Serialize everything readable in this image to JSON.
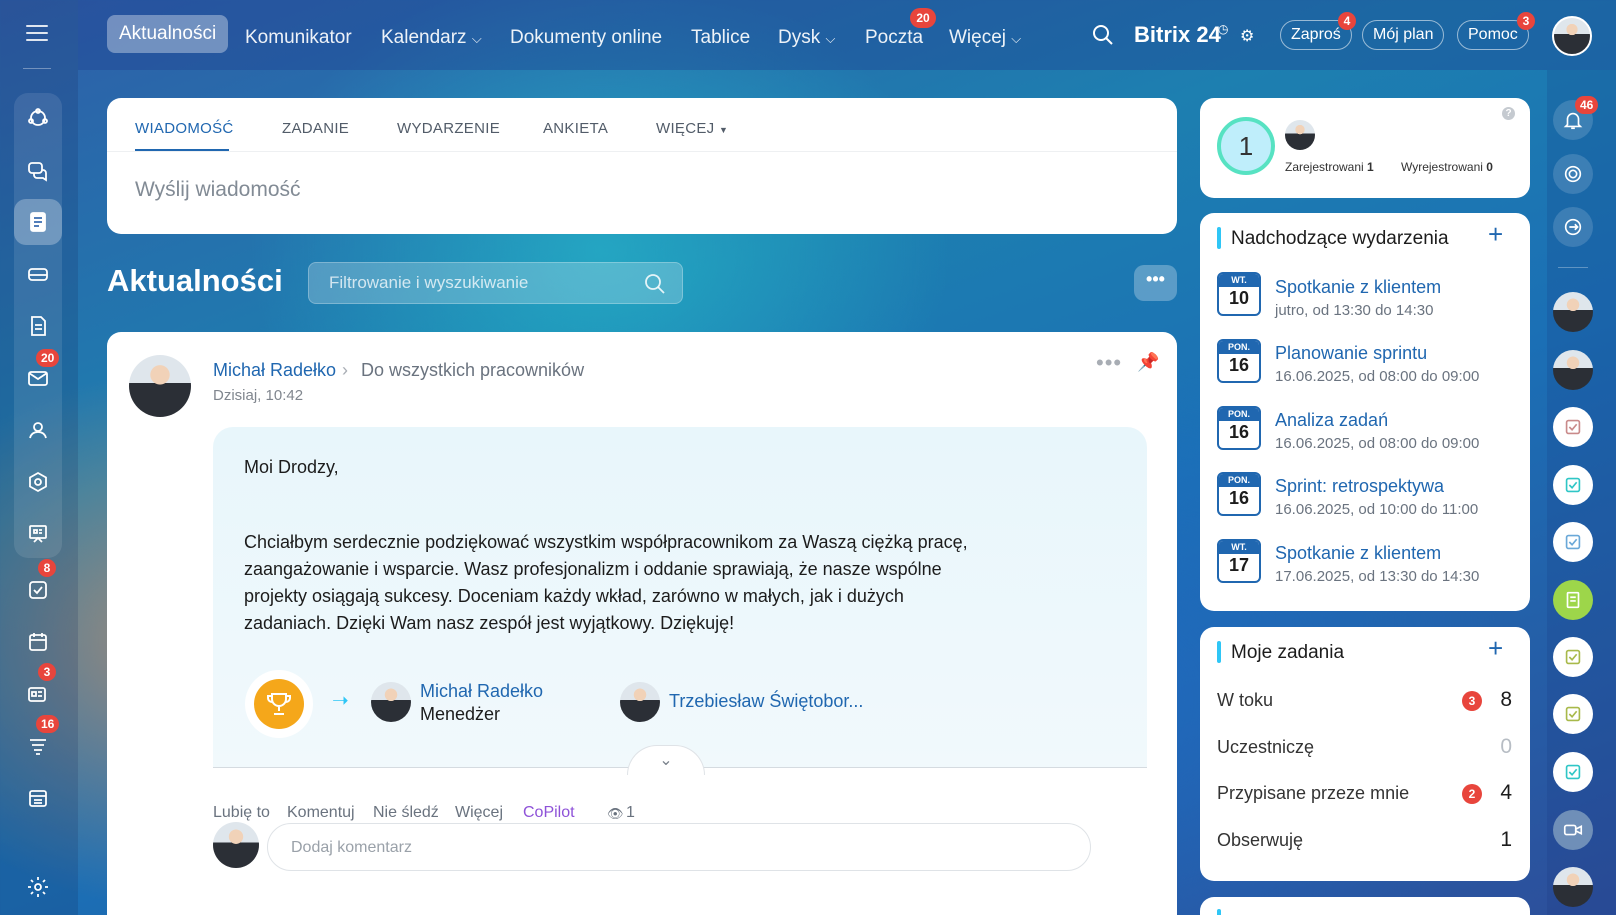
{
  "topbar": {
    "nav": [
      {
        "label": "Aktualności"
      },
      {
        "label": "Komunikator"
      },
      {
        "label": "Kalendarz"
      },
      {
        "label": "Dokumenty online"
      },
      {
        "label": "Tablice"
      },
      {
        "label": "Dysk"
      },
      {
        "label": "Poczta",
        "badge": "20"
      },
      {
        "label": "Więcej"
      }
    ],
    "logo": "Bitrix 24",
    "invite": {
      "label": "Zaproś",
      "badge": "4"
    },
    "myplan": "Mój plan",
    "help": {
      "label": "Pomoc",
      "badge": "3"
    }
  },
  "sidebar_badges": {
    "mail": "20",
    "tasks": "8",
    "feed": "3",
    "crm": "16"
  },
  "composer": {
    "tabs": [
      "WIADOMOŚĆ",
      "ZADANIE",
      "WYDARZENIE",
      "ANKIETA",
      "WIĘCEJ"
    ],
    "placeholder": "Wyślij wiadomość"
  },
  "feed": {
    "title": "Aktualności",
    "search_placeholder": "Filtrowanie i wyszukiwanie"
  },
  "post": {
    "author": "Michał Radełko",
    "audience": "Do wszystkich pracowników",
    "time": "Dzisiaj, 10:42",
    "greeting": "Moi Drodzy,",
    "body_lines": [
      "Chciałbym serdecznie podziękować wszystkim współpracownikom za Waszą ciężką pracę,",
      "zaangażowanie i wsparcie. Wasz profesjonalizm i oddanie sprawiają, że nasze wspólne",
      "projekty osiągają sukcesy. Doceniam każdy wkład, zarówno w małych, jak i dużych",
      "zadaniach. Dzięki Wam nasz zespół jest wyjątkowy. Dziękuję!"
    ],
    "giver": {
      "name": "Michał Radełko",
      "role": "Menedżer"
    },
    "receiver": {
      "name": "Trzebiesław Świętobor..."
    },
    "actions": [
      "Lubię to",
      "Komentuj",
      "Nie śledź",
      "Więcej",
      "CoPilot"
    ],
    "views": "1",
    "comment_placeholder": "Dodaj komentarz"
  },
  "presence": {
    "count": "1",
    "registered_label": "Zarejestrowani",
    "registered": "1",
    "unregistered_label": "Wyrejestrowani",
    "unregistered": "0"
  },
  "events": {
    "title": "Nadchodzące wydarzenia",
    "items": [
      {
        "day": "WT.",
        "date": "10",
        "title": "Spotkanie z klientem",
        "time": "jutro, od 13:30 do 14:30"
      },
      {
        "day": "PON.",
        "date": "16",
        "title": "Planowanie sprintu",
        "time": "16.06.2025, od 08:00 do 09:00"
      },
      {
        "day": "PON.",
        "date": "16",
        "title": "Analiza zadań",
        "time": "16.06.2025, od 08:00 do 09:00"
      },
      {
        "day": "PON.",
        "date": "16",
        "title": "Sprint: retrospektywa",
        "time": "16.06.2025, od 10:00 do 11:00"
      },
      {
        "day": "WT.",
        "date": "17",
        "title": "Spotkanie z klientem",
        "time": "17.06.2025, od 13:30 do 14:30"
      }
    ]
  },
  "tasks": {
    "title": "Moje zadania",
    "rows": [
      {
        "label": "W toku",
        "badge": "3",
        "value": "8"
      },
      {
        "label": "Uczestniczę",
        "badge": "",
        "value": "0"
      },
      {
        "label": "Przypisane przeze mnie",
        "badge": "2",
        "value": "4"
      },
      {
        "label": "Obserwuję",
        "badge": "",
        "value": "1"
      }
    ]
  },
  "notifications_badge": "46",
  "colors": {
    "accent": "#2067b0",
    "badge": "#e8453c",
    "trophy": "#f5a71a",
    "copilot": "#8e52d8"
  }
}
